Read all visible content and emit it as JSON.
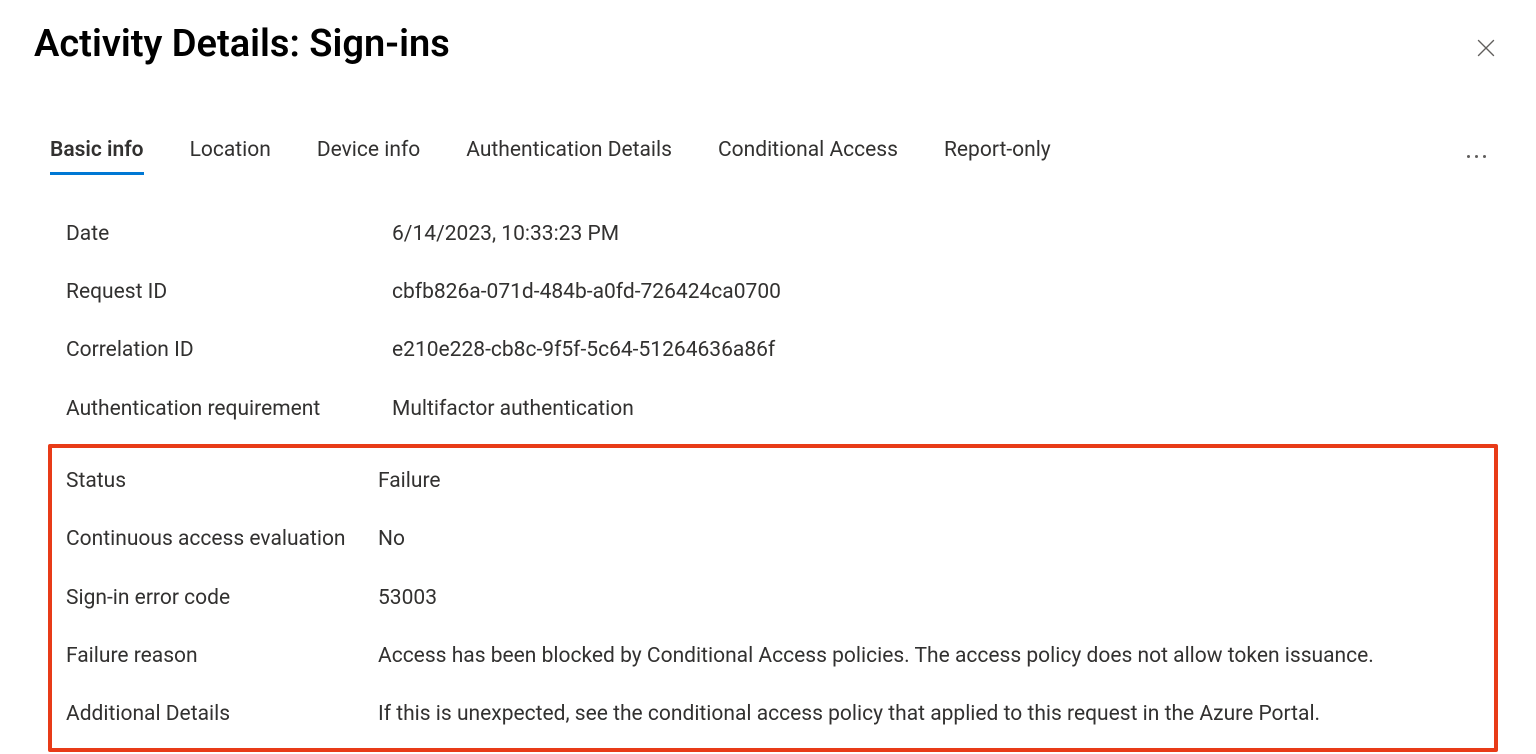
{
  "title": "Activity Details: Sign-ins",
  "tabs": [
    {
      "label": "Basic info",
      "active": true
    },
    {
      "label": "Location",
      "active": false
    },
    {
      "label": "Device info",
      "active": false
    },
    {
      "label": "Authentication Details",
      "active": false
    },
    {
      "label": "Conditional Access",
      "active": false
    },
    {
      "label": "Report-only",
      "active": false
    }
  ],
  "details_top": [
    {
      "label": "Date",
      "value": "6/14/2023, 10:33:23 PM"
    },
    {
      "label": "Request ID",
      "value": "cbfb826a-071d-484b-a0fd-726424ca0700"
    },
    {
      "label": "Correlation ID",
      "value": "e210e228-cb8c-9f5f-5c64-51264636a86f"
    },
    {
      "label": "Authentication requirement",
      "value": "Multifactor authentication"
    }
  ],
  "details_highlight": [
    {
      "label": "Status",
      "value": "Failure"
    },
    {
      "label": "Continuous access evaluation",
      "value": "No"
    },
    {
      "label": "Sign-in error code",
      "value": "53003"
    },
    {
      "label": "Failure reason",
      "value": "Access has been blocked by Conditional Access policies. The access policy does not allow token issuance."
    },
    {
      "label": "Additional Details",
      "value": "If this is unexpected, see the conditional access policy that applied to this request in the Azure Portal."
    }
  ]
}
